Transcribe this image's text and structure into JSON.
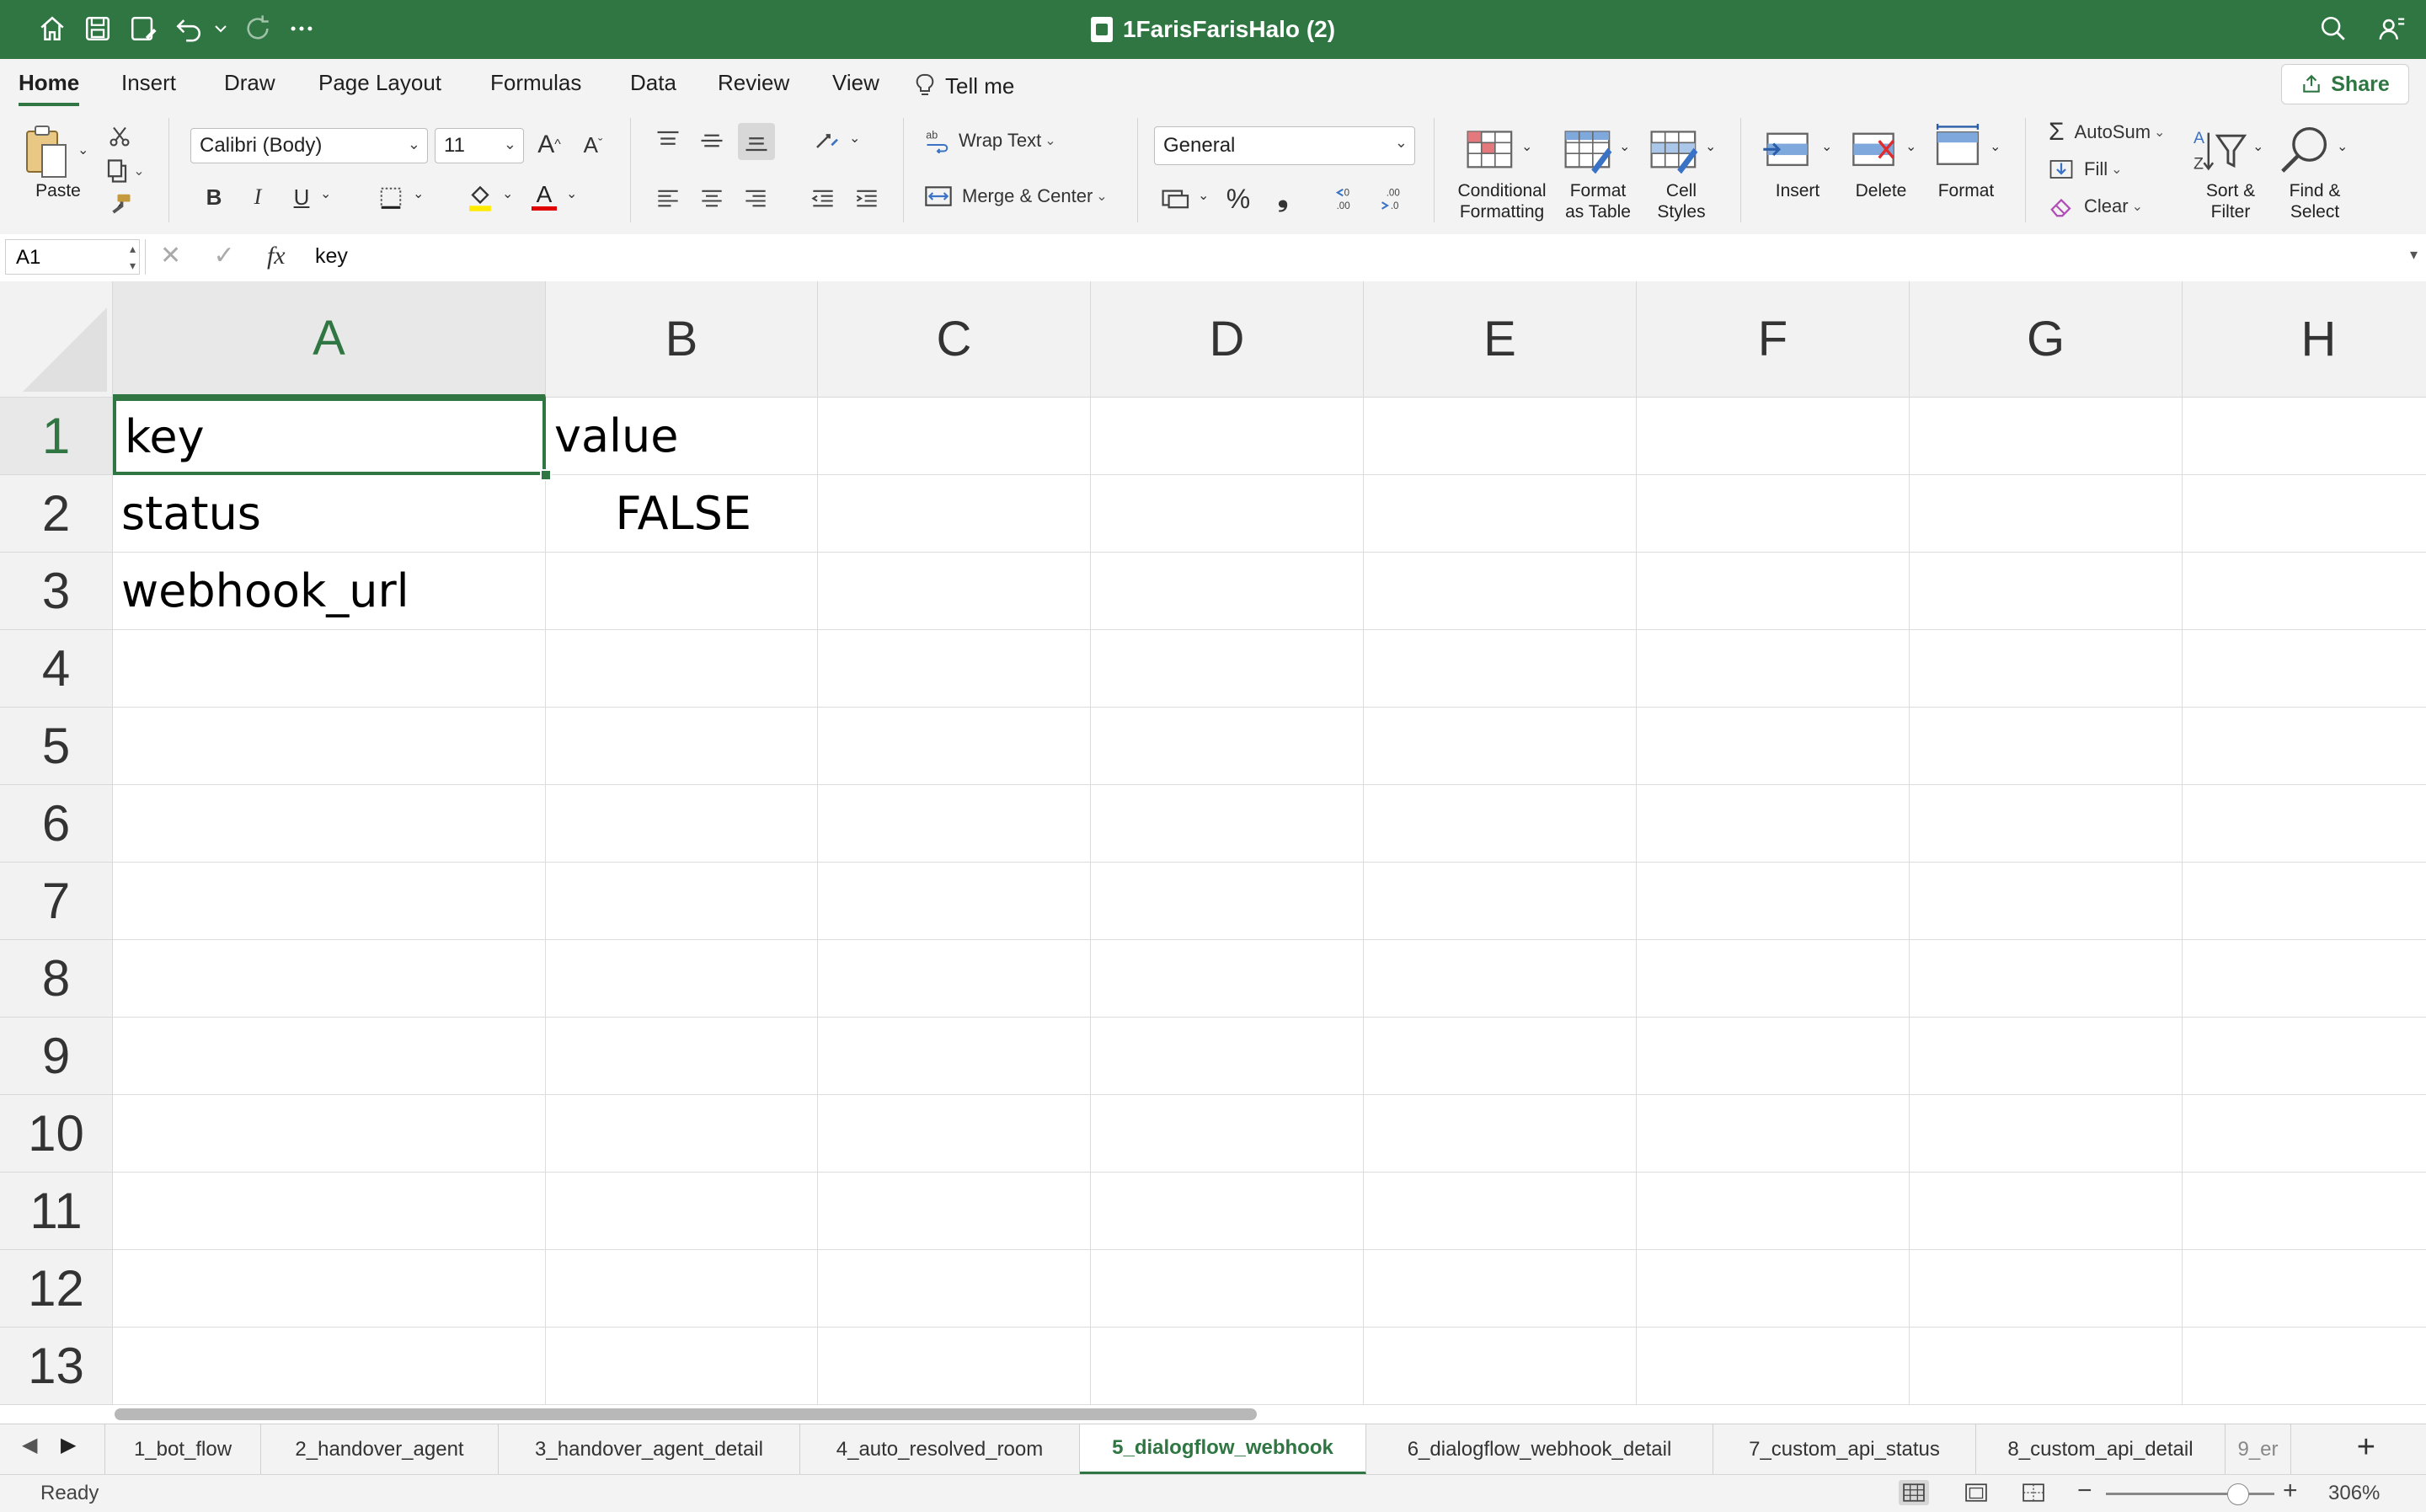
{
  "app": {
    "title": "1FarisFarisHalo (2)"
  },
  "ribbon_tabs": [
    "Home",
    "Insert",
    "Draw",
    "Page Layout",
    "Formulas",
    "Data",
    "Review",
    "View",
    "Tell me"
  ],
  "share_label": "Share",
  "ribbon": {
    "paste": "Paste",
    "font_name": "Calibri (Body)",
    "font_size": "11",
    "bold": "B",
    "italic": "I",
    "underline": "U",
    "wrap_text": "Wrap Text",
    "merge_center": "Merge & Center",
    "number_format": "General",
    "percent": "%",
    "conditional_formatting": "Conditional\nFormatting",
    "cond_1": "Conditional",
    "cond_2": "Formatting",
    "format_table_1": "Format",
    "format_table_2": "as Table",
    "cell_styles_1": "Cell",
    "cell_styles_2": "Styles",
    "insert": "Insert",
    "delete": "Delete",
    "format": "Format",
    "autosum": "AutoSum",
    "fill": "Fill",
    "clear": "Clear",
    "sort_1": "Sort &",
    "sort_2": "Filter",
    "find_1": "Find &",
    "find_2": "Select"
  },
  "formula_bar": {
    "name_box": "A1",
    "fx": "fx",
    "content": "key"
  },
  "columns": [
    "A",
    "B",
    "C",
    "D",
    "E",
    "F",
    "G",
    "H"
  ],
  "rows": [
    "1",
    "2",
    "3",
    "4",
    "5",
    "6",
    "7",
    "8",
    "9",
    "10",
    "11",
    "12",
    "13"
  ],
  "cells": {
    "A1": "key",
    "B1": "value",
    "A2": "status",
    "B2": "FALSE",
    "A3": "webhook_url"
  },
  "sheet_tabs": [
    "1_bot_flow",
    "2_handover_agent",
    "3_handover_agent_detail",
    "4_auto_resolved_room",
    "5_dialogflow_webhook",
    "6_dialogflow_webhook_detail",
    "7_custom_api_status",
    "8_custom_api_detail",
    "9_er"
  ],
  "active_sheet": "5_dialogflow_webhook",
  "status": {
    "text": "Ready",
    "zoom": "306%",
    "zoom_minus": "−",
    "zoom_plus": "+"
  },
  "colors": {
    "accent": "#2f7642"
  }
}
